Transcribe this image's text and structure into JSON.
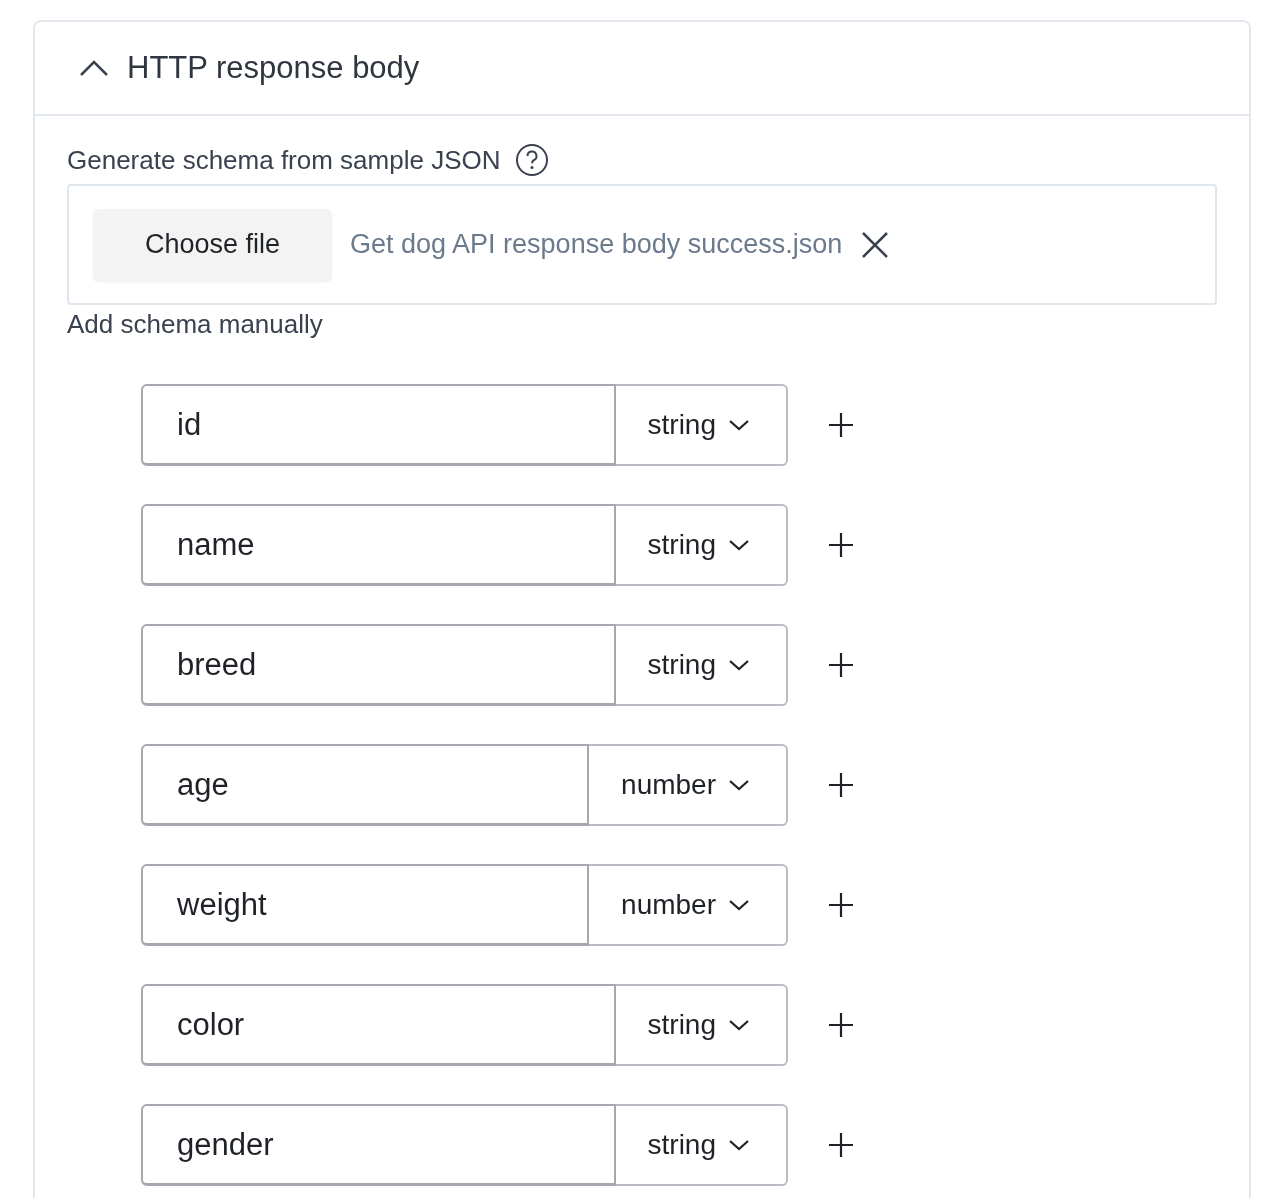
{
  "section": {
    "title": "HTTP response body",
    "expanded": true
  },
  "generate": {
    "label": "Generate schema from sample JSON",
    "button": "Choose file",
    "file_name": "Get dog API response body success.json"
  },
  "manual": {
    "label": "Add schema manually"
  },
  "fields": [
    {
      "name": "id",
      "type": "string"
    },
    {
      "name": "name",
      "type": "string"
    },
    {
      "name": "breed",
      "type": "string"
    },
    {
      "name": "age",
      "type": "number"
    },
    {
      "name": "weight",
      "type": "number"
    },
    {
      "name": "color",
      "type": "string"
    },
    {
      "name": "gender",
      "type": "string"
    }
  ]
}
